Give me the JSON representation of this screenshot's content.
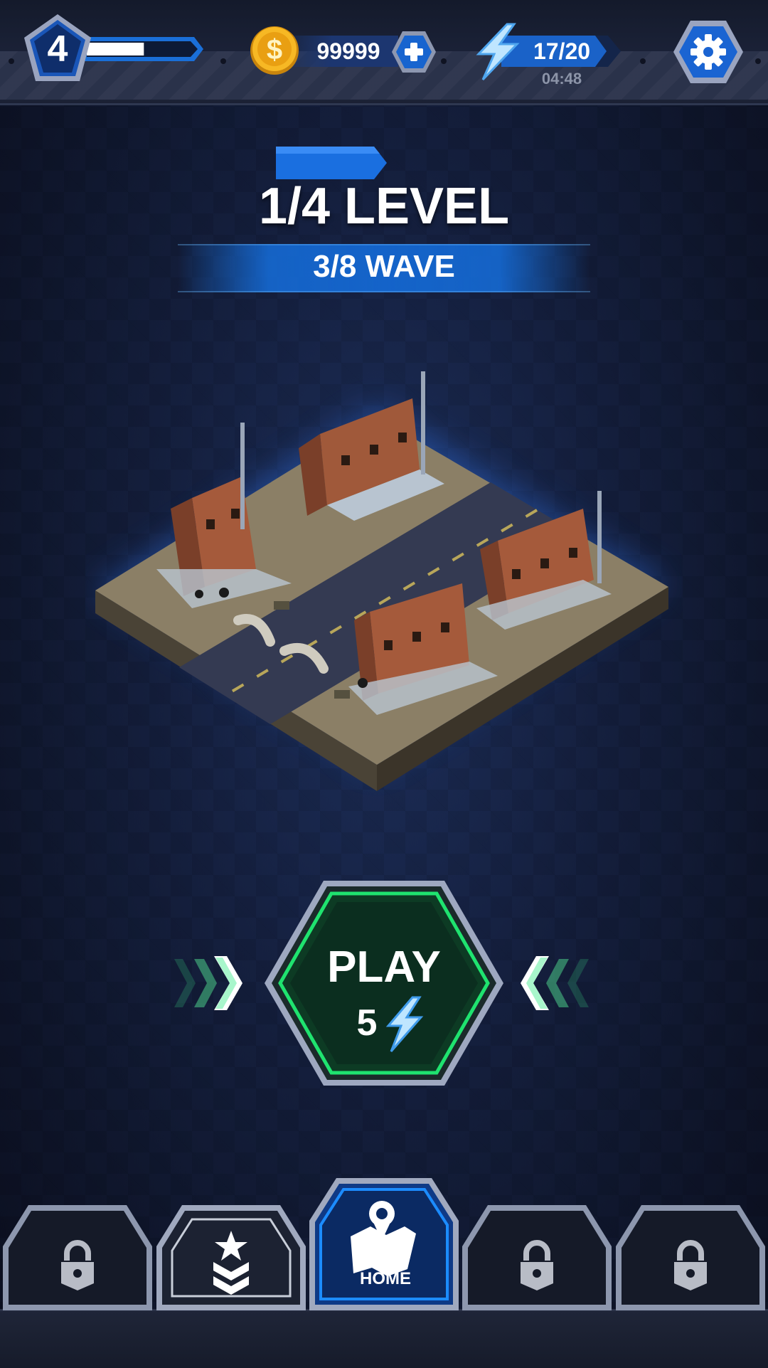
{
  "topbar": {
    "player_level": "4",
    "xp_progress": 0.55,
    "coins": "99999",
    "energy": "17/20",
    "energy_timer": "04:48",
    "icons": {
      "coin": "dollar-coin-icon",
      "add": "plus-icon",
      "energy": "lightning-bolt-icon",
      "settings": "gear-icon"
    }
  },
  "stage": {
    "level": "1/4 LEVEL",
    "wave": "3/8 WAVE"
  },
  "play": {
    "label": "PLAY",
    "cost": "5",
    "cost_icon": "lightning-bolt-icon"
  },
  "nav": {
    "tabs": [
      {
        "icon": "lock-icon",
        "locked": true
      },
      {
        "icon": "rank-star-chevron-icon",
        "locked": false
      },
      {
        "icon": "map-pin-icon",
        "label": "HOME",
        "active": true
      },
      {
        "icon": "lock-icon",
        "locked": true
      },
      {
        "icon": "lock-icon",
        "locked": true
      }
    ]
  },
  "colors": {
    "accent_blue": "#1577e6",
    "play_green": "#19e36b",
    "coin_gold": "#f4b21a",
    "energy_blue": "#6fc6ff"
  }
}
